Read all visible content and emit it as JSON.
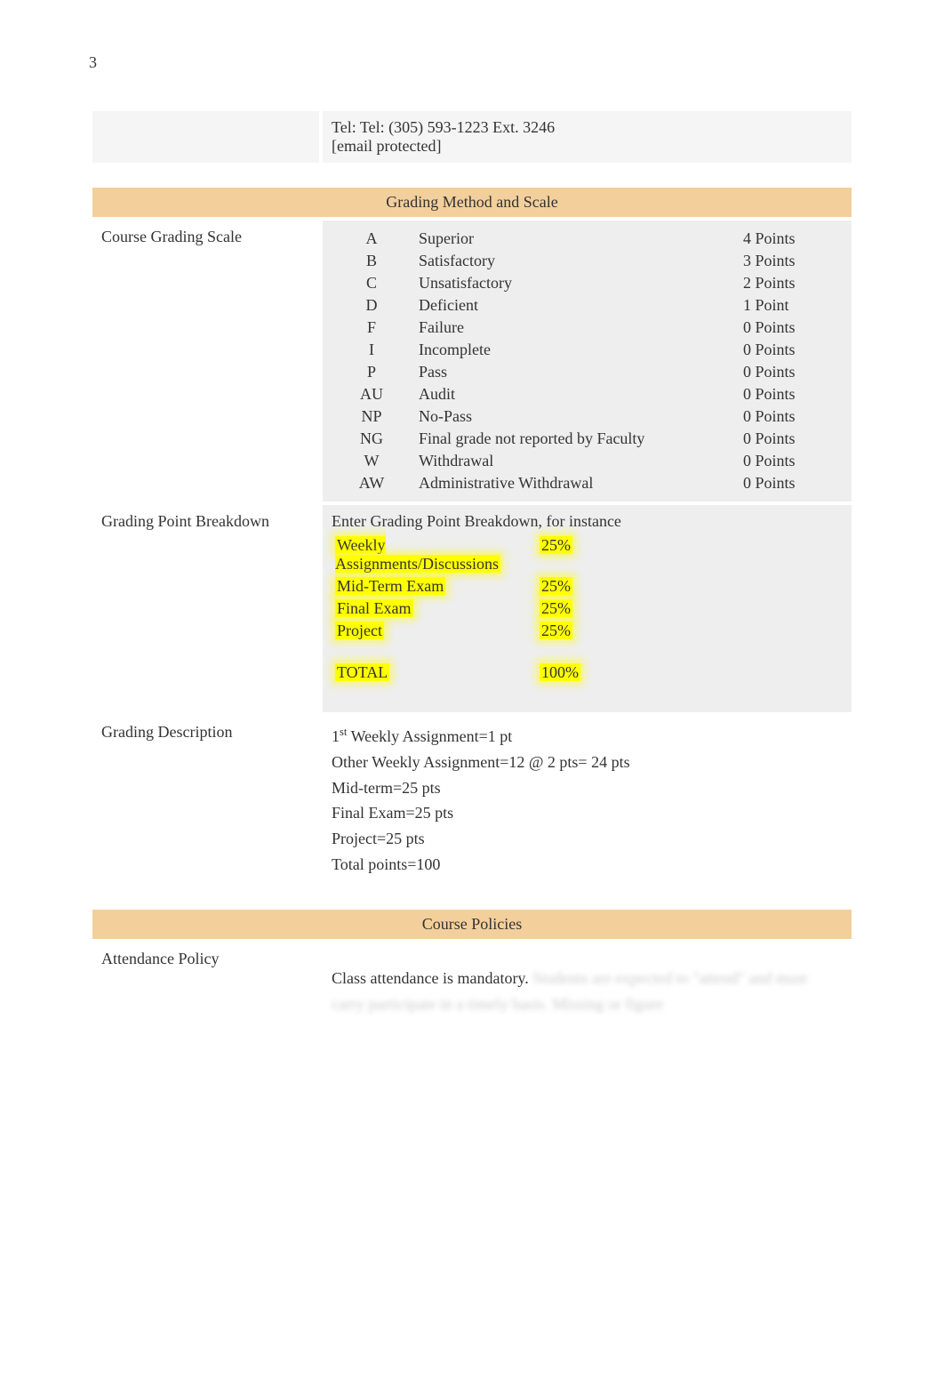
{
  "page_number": "3",
  "contact": {
    "tel": "Tel: Tel: (305) 593-1223 Ext. 3246",
    "email": "[email protected]"
  },
  "grading_method_header": "Grading Method and Scale",
  "course_grading_scale_label": "Course Grading Scale",
  "grading_scale": [
    {
      "code": "A",
      "desc": "Superior",
      "points": "4 Points"
    },
    {
      "code": "B",
      "desc": "Satisfactory",
      "points": "3 Points"
    },
    {
      "code": "C",
      "desc": "Unsatisfactory",
      "points": "2 Points"
    },
    {
      "code": "D",
      "desc": "Deficient",
      "points": "1 Point"
    },
    {
      "code": "F",
      "desc": "Failure",
      "points": "0 Points"
    },
    {
      "code": "I",
      "desc": "Incomplete",
      "points": "0 Points"
    },
    {
      "code": "P",
      "desc": "Pass",
      "points": "0 Points"
    },
    {
      "code": "AU",
      "desc": "Audit",
      "points": "0 Points"
    },
    {
      "code": "NP",
      "desc": "No-Pass",
      "points": "0 Points"
    },
    {
      "code": "NG",
      "desc": "Final grade not reported by Faculty",
      "points": "0 Points"
    },
    {
      "code": "W",
      "desc": "Withdrawal",
      "points": "0 Points"
    },
    {
      "code": "AW",
      "desc": "Administrative Withdrawal",
      "points": "0 Points"
    }
  ],
  "grading_point_breakdown_label": "Grading Point Breakdown",
  "breakdown_intro": "Enter Grading Point Breakdown, for instance",
  "breakdown": [
    {
      "label": "Weekly Assignments/Discussions",
      "value": "25%"
    },
    {
      "label": "Mid-Term Exam",
      "value": "25%"
    },
    {
      "label": "Final Exam",
      "value": "25%"
    },
    {
      "label": "Project",
      "value": "25%"
    }
  ],
  "breakdown_total_label": "TOTAL",
  "breakdown_total_value": "100%",
  "grading_description_label": "Grading Description",
  "grading_description": {
    "line1_prefix": "1",
    "line1_super": "st",
    "line1_rest": " Weekly Assignment=1 pt",
    "line2": "Other Weekly Assignment=12 @ 2 pts= 24 pts",
    "line3": "Mid-term=25 pts",
    "line4": "Final Exam=25 pts",
    "line5": "Project=25 pts",
    "line6": "Total points=100"
  },
  "course_policies_header": "Course Policies",
  "attendance_policy_label": "Attendance Policy",
  "attendance_text": "Class attendance is mandatory.  ",
  "attendance_blurred": "Students are expected to \"attend\" and must carry participate in a timely basis.  Missing or figure"
}
